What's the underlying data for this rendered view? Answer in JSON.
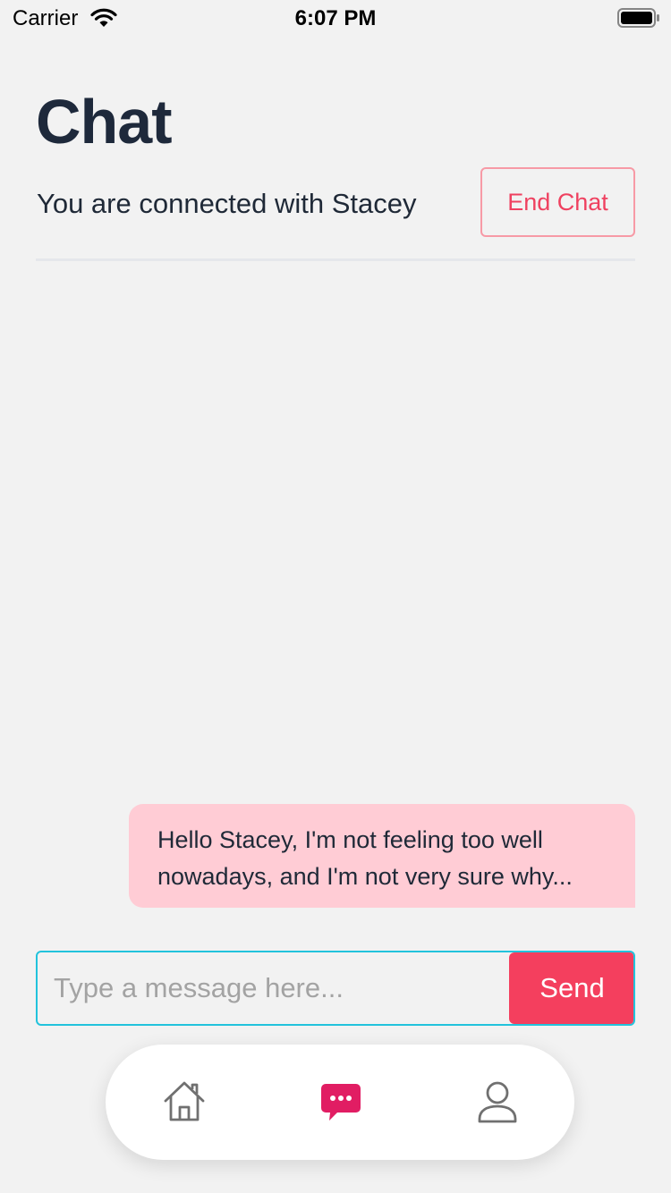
{
  "status_bar": {
    "carrier": "Carrier",
    "time": "6:07 PM"
  },
  "header": {
    "title": "Chat",
    "connected_text": "You are connected with Stacey",
    "end_chat_label": "End Chat"
  },
  "messages": [
    {
      "sender": "me",
      "text": "Hello Stacey, I'm not feeling too well nowadays, and I'm not very sure why..."
    }
  ],
  "composer": {
    "placeholder": "Type a message here...",
    "send_label": "Send"
  },
  "bottom_nav": {
    "items": [
      {
        "icon": "home-icon",
        "active": false
      },
      {
        "icon": "chat-icon",
        "active": true
      },
      {
        "icon": "profile-icon",
        "active": false
      }
    ]
  },
  "colors": {
    "accent": "#f43f5e",
    "active_nav": "#e11d63",
    "bubble": "#ffccd5",
    "input_border": "#22c3dc"
  }
}
